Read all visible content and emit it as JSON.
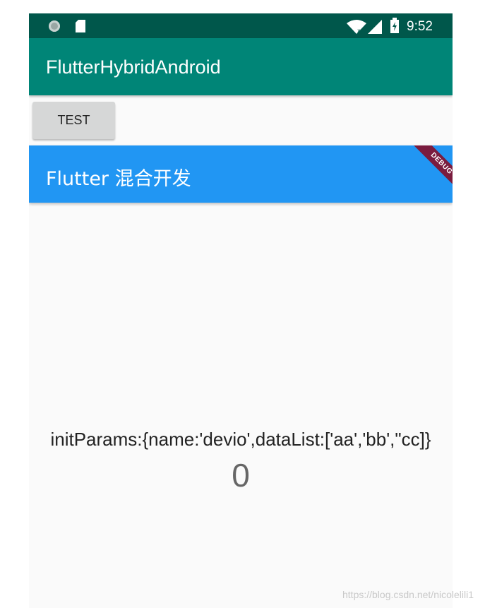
{
  "status_bar": {
    "time": "9:52",
    "icons": [
      "notification-dot-icon",
      "sd-card-icon",
      "wifi-icon",
      "cell-signal-icon",
      "battery-charging-icon"
    ]
  },
  "app_bar": {
    "title": "FlutterHybridAndroid",
    "color": "#008577"
  },
  "test_button": {
    "label": "TEST"
  },
  "flutter_bar": {
    "title": "Flutter 混合开发",
    "color": "#2196f3",
    "debug_label": "DEBUG"
  },
  "body": {
    "params": "initParams:{name:'devio',dataList:['aa','bb',\"cc]}",
    "counter": "0"
  },
  "watermark": "https://blog.csdn.net/nicolelili1"
}
